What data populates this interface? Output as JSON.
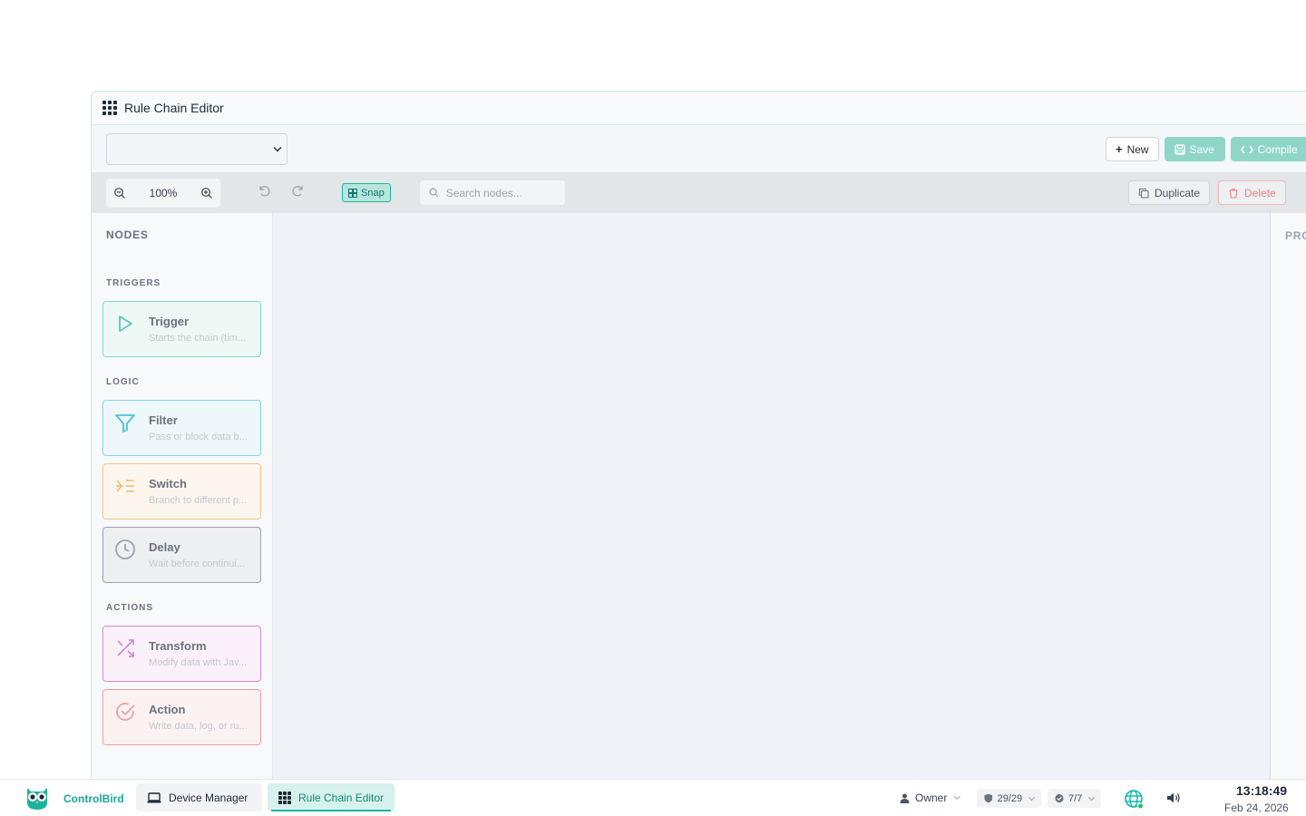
{
  "window": {
    "title": "Rule Chain Editor"
  },
  "topbar": {
    "chain_select_value": "",
    "new_label": "New",
    "save_label": "Save",
    "compile_label": "Compile"
  },
  "toolbar": {
    "zoom": "100%",
    "snap_label": "Snap",
    "search_placeholder": "Search nodes...",
    "duplicate_label": "Duplicate",
    "delete_label": "Delete"
  },
  "sidebar": {
    "title": "NODES",
    "sections": [
      {
        "label": "TRIGGERS",
        "nodes": [
          {
            "name": "Trigger",
            "desc": "Starts the chain (tim...",
            "icon": "play-icon",
            "color": "#5cc9b5"
          }
        ]
      },
      {
        "label": "LOGIC",
        "nodes": [
          {
            "name": "Filter",
            "desc": "Pass or block data b...",
            "icon": "filter-icon",
            "color": "#4cc0dc"
          },
          {
            "name": "Switch",
            "desc": "Branch to different p...",
            "icon": "branch-icon",
            "color": "#f6b874"
          },
          {
            "name": "Delay",
            "desc": "Wait before continui...",
            "icon": "clock-icon",
            "color": "#9ca3af"
          }
        ]
      },
      {
        "label": "ACTIONS",
        "nodes": [
          {
            "name": "Transform",
            "desc": "Modify data with Jav...",
            "icon": "shuffle-icon",
            "color": "#d48ad4"
          },
          {
            "name": "Action",
            "desc": "Write data, log, or ru...",
            "icon": "check-circle-icon",
            "color": "#f0a0a0"
          }
        ]
      }
    ]
  },
  "properties": {
    "title": "PRO"
  },
  "taskbar": {
    "brand": "ControlBird",
    "tasks": [
      {
        "label": "Device Manager",
        "icon": "laptop-icon"
      },
      {
        "label": "Rule Chain Editor",
        "icon": "grid-icon"
      }
    ],
    "user": "Owner",
    "shield_count": "29/29",
    "check_count": "7/7",
    "time": "13:18:49",
    "date": "Feb 24, 2026"
  },
  "colors": {
    "accent": "#14b8a6",
    "save_bg": "#8fd6c8"
  }
}
